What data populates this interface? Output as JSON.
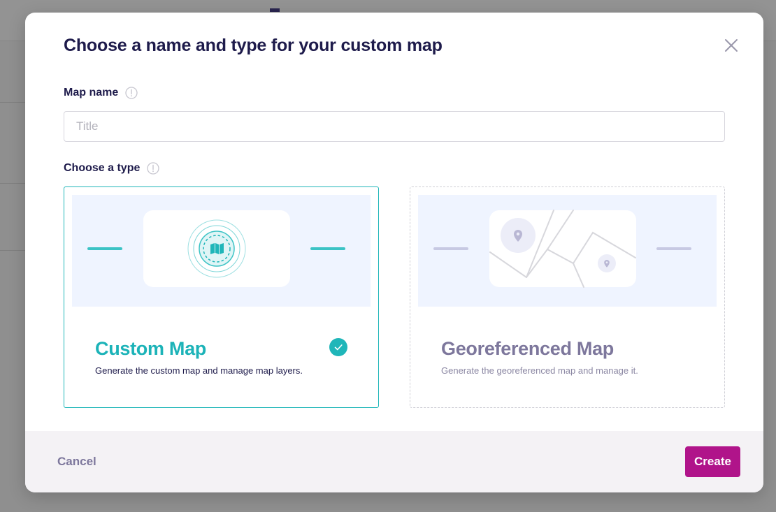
{
  "dialog": {
    "title": "Choose a name and type for your custom map",
    "close_icon": "close-icon"
  },
  "map_name": {
    "label": "Map name",
    "info_icon": "info-icon",
    "value": "",
    "placeholder": "Title"
  },
  "type_section": {
    "label": "Choose a type",
    "info_icon": "info-icon",
    "options": [
      {
        "title": "Custom Map",
        "description": "Generate the custom map and manage map layers.",
        "selected": true,
        "illustration_icon": "map-icon"
      },
      {
        "title": "Georeferenced Map",
        "description": "Generate the georeferenced map and manage it.",
        "selected": false,
        "illustration_icon": "location-pin-icon"
      }
    ]
  },
  "footer": {
    "cancel_label": "Cancel",
    "create_label": "Create"
  },
  "colors": {
    "accent_teal": "#1fb6b9",
    "primary_magenta": "#b0148a",
    "heading_navy": "#1e1b4b",
    "muted_purple": "#7d779c"
  }
}
